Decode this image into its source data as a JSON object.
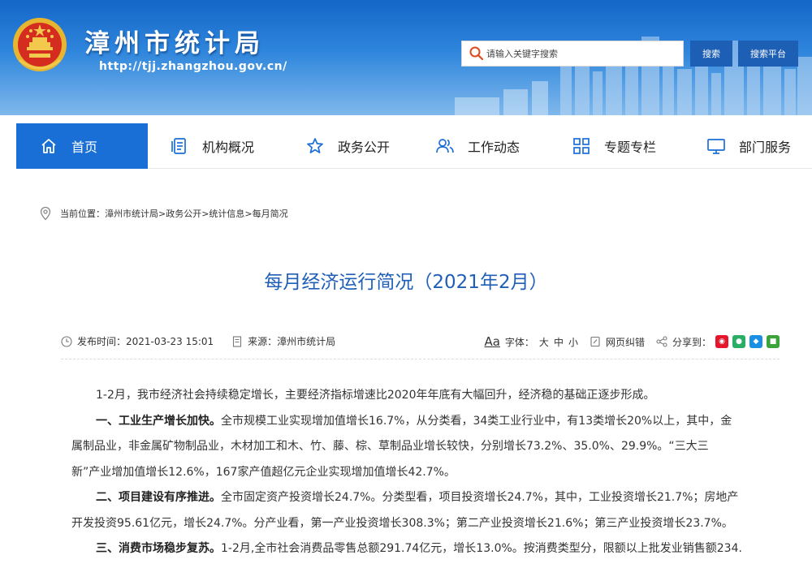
{
  "header": {
    "site_title": "漳州市统计局",
    "site_url": "http://tjj.zhangzhou.gov.cn/",
    "search_placeholder": "请输入关键字搜索",
    "search_button": "搜索",
    "platform_button": "搜索平台",
    "colors": {
      "brand_blue": "#1a6fd6",
      "button_blue": "#1e5fb6"
    }
  },
  "nav": {
    "items": [
      {
        "label": "首页",
        "icon": "home-icon",
        "active": true
      },
      {
        "label": "机构概况",
        "icon": "document-list-icon"
      },
      {
        "label": "政务公开",
        "icon": "star-icon"
      },
      {
        "label": "工作动态",
        "icon": "people-icon"
      },
      {
        "label": "专题专栏",
        "icon": "grid-icon"
      },
      {
        "label": "部门服务",
        "icon": "monitor-icon"
      }
    ]
  },
  "breadcrumb": {
    "prefix": "当前位置：",
    "path": "漳州市统计局>政务公开>统计信息>每月简况"
  },
  "article": {
    "title": "每月经济运行简况（2021年2月）",
    "publish_label": "发布时间：",
    "publish_time": "2021-03-23 15:01",
    "source_label": "来源：",
    "source": "漳州市统计局",
    "font_label": "字体：",
    "font_sizes": [
      "大",
      "中",
      "小"
    ],
    "aa": "Aa",
    "correction": "网页纠错",
    "share_label": "分享到："
  },
  "content": {
    "p1": "1-2月，我市经济社会持续稳定增长，主要经济指标增速比2020年年底有大幅回升，经济稳的基础正逐步形成。",
    "p2_head": "一、工业生产增长加快。",
    "p2_line1": "全市规模工业实现增加值增长16.7%，从分类看，34类工业行业中，有13类增长20%以上，其中，金",
    "p2_line2": "属制品业，非金属矿物制品业，木材加工和木、竹、藤、棕、草制品业增长较快，分别增长73.2%、35.0%、29.9%。“三大三",
    "p2_line3": "新”产业增加值增长12.6%，167家产值超亿元企业实现增加值增长42.7%。",
    "p3_head": "二、项目建设有序推进。",
    "p3_line1": "全市固定资产投资增长24.7%。分类型看，项目投资增长24.7%，其中，工业投资增长21.7%；房地产",
    "p3_line2": "开发投资95.61亿元，增长24.7%。分产业看，第一产业投资增长308.3%；第二产业投资增长21.6%；第三产业投资增长23.7%。",
    "p4_head": "三、消费市场稳步复苏。",
    "p4_line1": "1-2月,全市社会消费品零售总额291.74亿元，增长13.0%。按消费类型分，限额以上批发业销售额234."
  }
}
